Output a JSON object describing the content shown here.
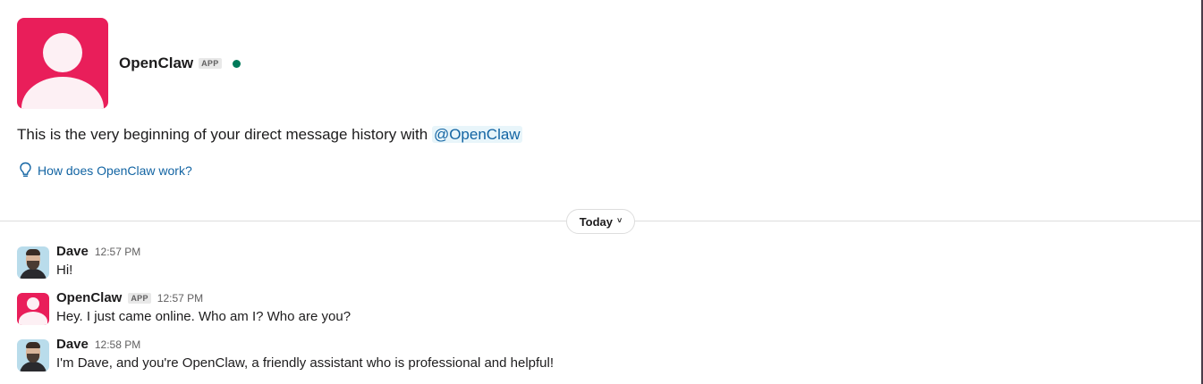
{
  "intro": {
    "name": "OpenClaw",
    "app_badge": "APP",
    "text_prefix": "This is the very beginning of your direct message history with",
    "mention": "@OpenClaw",
    "help_link": "How does OpenClaw work?"
  },
  "divider": {
    "date_label": "Today",
    "chevron": "˅"
  },
  "messages": [
    {
      "sender": "Dave",
      "is_app": false,
      "time": "12:57 PM",
      "text": "Hi!"
    },
    {
      "sender": "OpenClaw",
      "is_app": true,
      "app_badge": "APP",
      "time": "12:57 PM",
      "text": "Hey. I just came online. Who am I? Who are you?"
    },
    {
      "sender": "Dave",
      "is_app": false,
      "time": "12:58 PM",
      "text": "I'm Dave, and you're OpenClaw, a friendly assistant who is professional and helpful!"
    }
  ],
  "colors": {
    "app_avatar": "#e91e5a",
    "presence_online": "#007a5a",
    "link": "#1264a3",
    "mention_bg": "#e8f5fa"
  },
  "icons": {
    "help": "lightbulb-icon",
    "presence": "presence-online-icon",
    "date_menu": "chevron-down-icon"
  }
}
